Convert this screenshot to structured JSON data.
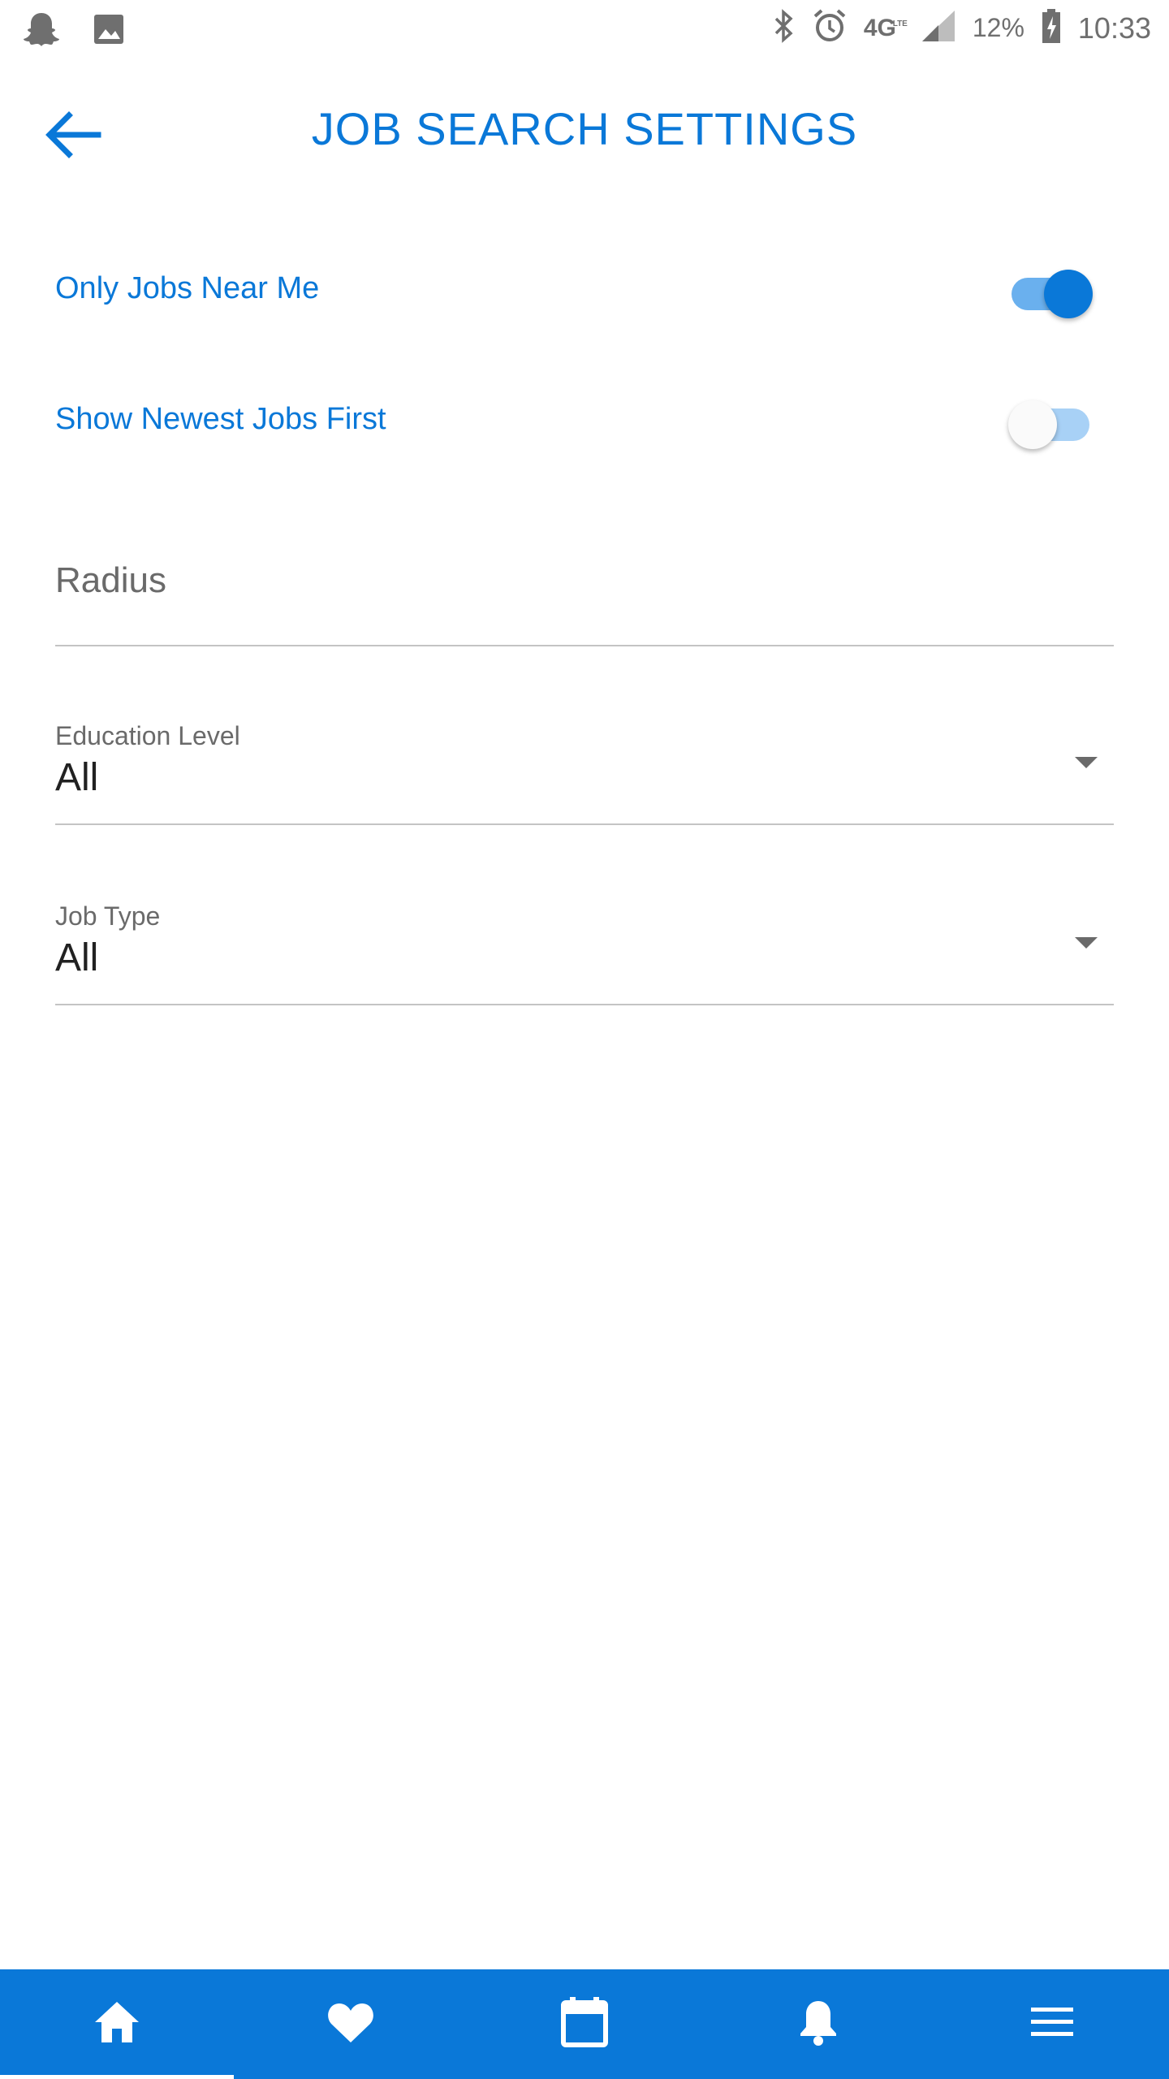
{
  "status_bar": {
    "left_icons": [
      "snapchat-ghost-icon",
      "image-icon"
    ],
    "network": "4G",
    "network_sub": "LTE",
    "battery_percent": "12%",
    "time": "10:33"
  },
  "app_bar": {
    "title": "JOB SEARCH SETTINGS",
    "back_icon": "arrow-left-icon"
  },
  "settings": {
    "toggles": [
      {
        "label": "Only Jobs Near Me",
        "on": true
      },
      {
        "label": "Show Newest Jobs First",
        "on": false
      }
    ],
    "radius": {
      "placeholder": "Radius",
      "value": ""
    },
    "education": {
      "label": "Education Level",
      "value": "All"
    },
    "job_type": {
      "label": "Job Type",
      "value": "All"
    }
  },
  "bottom_nav": {
    "items": [
      {
        "icon": "home-icon",
        "active": true
      },
      {
        "icon": "heart-icon",
        "active": false
      },
      {
        "icon": "calendar-icon",
        "active": false
      },
      {
        "icon": "bell-icon",
        "active": false
      },
      {
        "icon": "menu-icon",
        "active": false
      }
    ]
  },
  "colors": {
    "accent": "#0a78d8",
    "toggle_track_on": "#6ab0ee",
    "toggle_track_off": "#a8d1f6",
    "text_secondary": "#6a6a6a"
  }
}
